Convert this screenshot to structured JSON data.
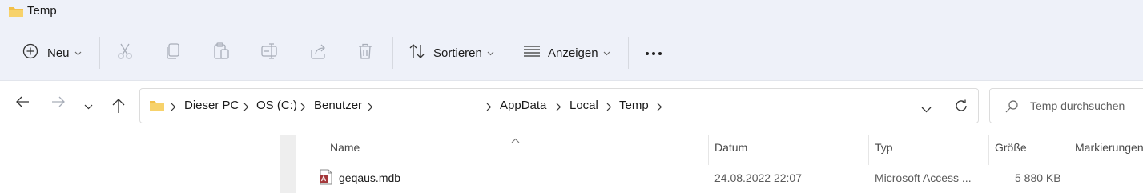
{
  "window": {
    "title": "Temp"
  },
  "toolbar": {
    "new_label": "Neu",
    "sort_label": "Sortieren",
    "view_label": "Anzeigen",
    "icons": [
      "plus-circle-icon",
      "scissors-icon",
      "copy-icon",
      "paste-icon",
      "rename-icon",
      "share-icon",
      "trash-icon",
      "sort-icon",
      "view-icon",
      "more-icon"
    ]
  },
  "breadcrumb": [
    "Dieser PC",
    "OS (C:)",
    "Benutzer",
    "AppData",
    "Local",
    "Temp"
  ],
  "search": {
    "placeholder": "Temp durchsuchen"
  },
  "columns": [
    "Name",
    "Datum",
    "Typ",
    "Größe",
    "Markierungen"
  ],
  "files": [
    {
      "name": "geqaus.mdb",
      "date": "24.08.2022 22:07",
      "type": "Microsoft Access ...",
      "size": "5 880 KB"
    }
  ],
  "colors": {
    "chrome_bg": "#eef1f9",
    "folder_yellow": "#f2c04a",
    "access_red": "#a4373a"
  }
}
